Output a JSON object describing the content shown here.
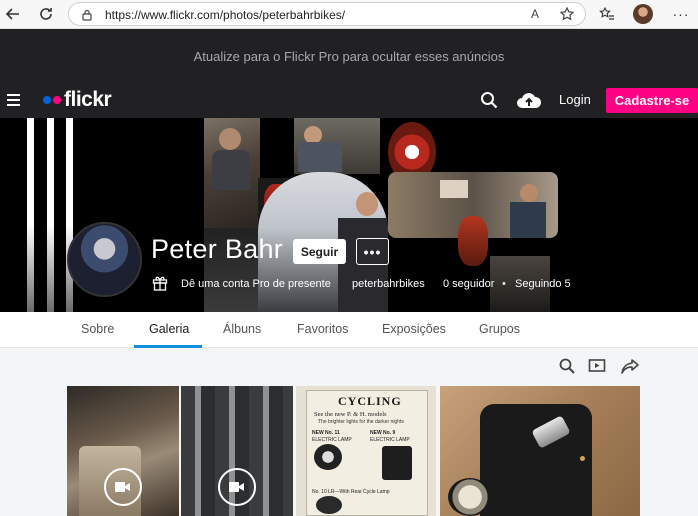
{
  "browser": {
    "url": "https://www.flickr.com/photos/peterbahrbikes/",
    "reader_label": "A"
  },
  "ad_banner": {
    "text": "Atualize para o Flickr Pro para ocultar esses anúncios"
  },
  "header": {
    "logo": "flickr",
    "login_label": "Login",
    "signup_label": "Cadastre-se",
    "brand_colors": {
      "blue": "#0063dc",
      "pink": "#ff0084"
    }
  },
  "profile": {
    "name": "Peter Bahr",
    "follow_label": "Seguir",
    "more_label": "•••",
    "gift_text": "Dê uma conta Pro de presente",
    "username": "peterbahrbikes",
    "followers": "0 seguidor",
    "separator": "•",
    "following": "Seguindo 5"
  },
  "tabs": [
    {
      "label": "Sobre"
    },
    {
      "label": "Galeria",
      "active": true
    },
    {
      "label": "Álbuns"
    },
    {
      "label": "Favoritos"
    },
    {
      "label": "Exposições"
    },
    {
      "label": "Grupos"
    }
  ],
  "accent": "#128fdc",
  "thumbnails": [
    {
      "kind": "video"
    },
    {
      "kind": "video"
    },
    {
      "kind": "photo",
      "caption_top": "CYCLING",
      "caption_lines": [
        "See the new P. & H. models",
        "The brighter lights for the darker nights",
        "NEW No. 11",
        "ELECTRIC LAMP",
        "NEW No. 9",
        "ELECTRIC LAMP",
        "No. 10 LR—With Rear Cycle Lamp"
      ]
    },
    {
      "kind": "photo"
    }
  ]
}
